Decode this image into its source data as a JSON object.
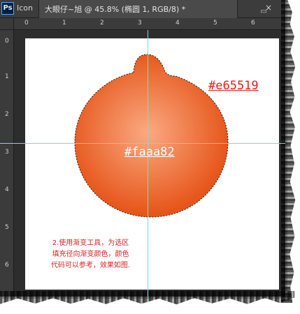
{
  "window": {
    "app_icon_text": "Ps",
    "tab_short": "Icon",
    "document_title": "大眼仔~旭 @ 45.8% (椭圆 1, RGB/8) *",
    "close_glyph": "×"
  },
  "window_controls": {
    "minimize": "▭",
    "maximize": "□"
  },
  "rulers": {
    "top_labels": [
      "0",
      "1",
      "2",
      "3",
      "4",
      "5",
      "6"
    ],
    "left_labels": [
      "0",
      "1",
      "2",
      "3",
      "4",
      "5",
      "6"
    ]
  },
  "canvas": {
    "accent_color_code": "#e65519",
    "center_color_code": "#faaa82",
    "instruction_text": "2.使用渐变工具，为选区\n填充径向渐变颜色，颜色\n代码可以参考，效果如图."
  },
  "gradient": {
    "center_color": "#faaa82",
    "outer_color": "#e65519",
    "guide_color": "#63e3e3",
    "text_red": "#e02020"
  },
  "icons": {
    "app_icon": "photoshop-app-icon",
    "close_icon": "close-icon",
    "minimize_icon": "minimize-icon",
    "maximize_icon": "maximize-icon"
  }
}
